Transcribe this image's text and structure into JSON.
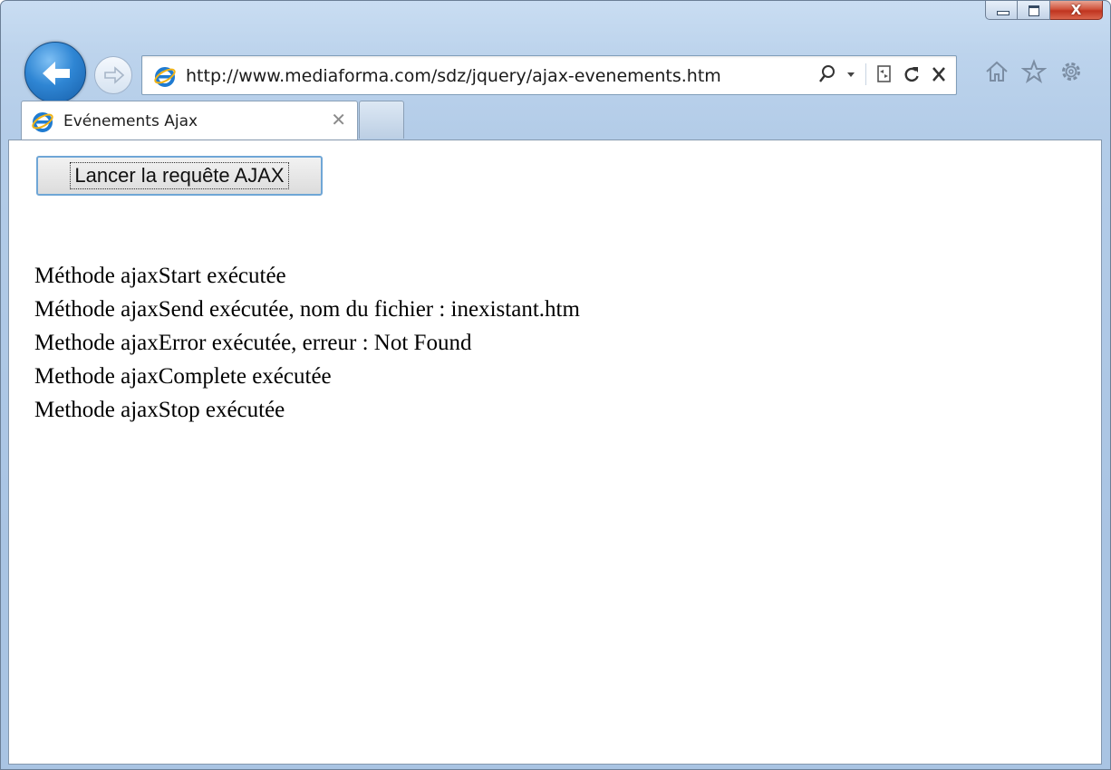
{
  "browser": {
    "url": "http://www.mediaforma.com/sdz/jquery/ajax-evenements.htm",
    "tab_title": "Evénements Ajax",
    "tab_close": "✕",
    "close_glyph": "X",
    "icons": [
      "back-arrow-icon",
      "forward-arrow-icon",
      "ie-logo-icon",
      "search-icon",
      "dropdown-arrow-icon",
      "compatibility-view-icon",
      "refresh-icon",
      "stop-icon",
      "home-icon",
      "favorites-star-icon",
      "gear-icon"
    ]
  },
  "page": {
    "button_label": "Lancer la requête AJAX",
    "log_lines": [
      "Méthode ajaxStart exécutée",
      "Méthode ajaxSend exécutée, nom du fichier : inexistant.htm",
      "Methode ajaxError exécutée, erreur : Not Found",
      "Methode ajaxComplete exécutée",
      "Methode ajaxStop exécutée"
    ]
  },
  "colors": {
    "chrome": "#bcd3ec",
    "close_button": "#c0341f",
    "back_button": "#2f86d4",
    "ie_logo": "#1f7bd1"
  }
}
